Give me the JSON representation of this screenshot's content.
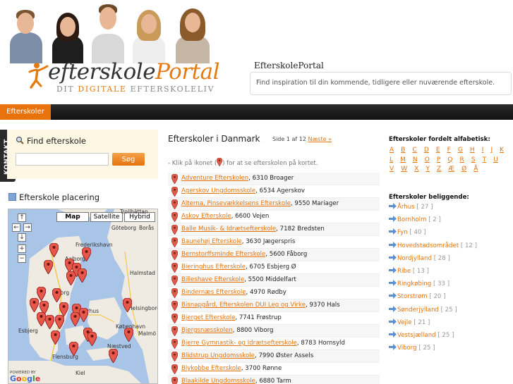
{
  "header": {
    "logo_word1": "efterskole",
    "logo_word2": "Portal",
    "logo_sub_1": "DIT",
    "logo_sub_2": "DIGITALE",
    "logo_sub_3": "EFTERSKOLELIV",
    "site_title": "EfterskolePortal",
    "tagline": "Find inspiration til din kommende, tidligere eller nuværende efterskole."
  },
  "nav": {
    "active_tab": "Efterskoler"
  },
  "kontakt": "KONTAKT",
  "search": {
    "heading": "Find efterskole",
    "placeholder": "",
    "button": "Søg"
  },
  "map_section": {
    "heading": "Efterskole placering",
    "buttons": [
      "Map",
      "Satellite",
      "Hybrid"
    ],
    "cities": [
      "Trollhättan",
      "Göteborg",
      "Borås",
      "Frederikshavn",
      "Aalborg",
      "Halmstad",
      "Viborg",
      "Helsingborg",
      "Aarhus",
      "Esbjerg",
      "København",
      "Malmö",
      "Næstved",
      "Flensburg",
      "Kiel"
    ],
    "powered_by": "POWERED BY",
    "google": "Google"
  },
  "main": {
    "title": "Efterskoler i Danmark",
    "pager_text": "Side 1 af 12",
    "pager_next": "Næste »",
    "hint_before": "- Klik på ikonet (",
    "hint_after": ") for at se efterskolen på kortet.",
    "schools": [
      {
        "name": "Adventure Efterskolen",
        "addr": ", 6310 Broager"
      },
      {
        "name": "Agerskov Ungdomsskole",
        "addr": ", 6534 Agerskov"
      },
      {
        "name": "Alterna, Pinsevækkelsens Efterskole",
        "addr": ", 9550 Mariager"
      },
      {
        "name": "Askov Efterskole",
        "addr": ", 6600 Vejen"
      },
      {
        "name": "Balle Musik- & Idrætsefterskole",
        "addr": ", 7182 Bredsten"
      },
      {
        "name": "Baunehøj Efterskole",
        "addr": ", 3630 Jægerspris"
      },
      {
        "name": "Bernstorffsminde Efterskole",
        "addr": ", 5600 Fåborg"
      },
      {
        "name": "Bieringhus Efterskole",
        "addr": ", 6705 Esbjerg Ø"
      },
      {
        "name": "Billeshave Efterskole",
        "addr": ", 5500 Middelfart"
      },
      {
        "name": "Bindernæs Efterskole",
        "addr": ", 4970 Rødby"
      },
      {
        "name": "Bisnapgård, Efterskolen DUI Leg og Virke",
        "addr": ", 9370 Hals"
      },
      {
        "name": "Bjerget Efterskole",
        "addr": ", 7741 Frøstrup"
      },
      {
        "name": "Bjergsnæsskolen",
        "addr": ", 8800 Viborg"
      },
      {
        "name": "Bjerre Gymnastik- og Idrætsefterskole",
        "addr": ", 8783 Hornsyld"
      },
      {
        "name": "Blidstrup Ungdomsskole",
        "addr": ", 7990 Øster Assels"
      },
      {
        "name": "Blykobbe Efterskole",
        "addr": ", 3700 Rønne"
      },
      {
        "name": "Blaakilde Ungdomsskole",
        "addr": ", 6880 Tarm"
      }
    ]
  },
  "right": {
    "alpha_heading": "Efterskoler fordelt alfabetisk:",
    "letters": [
      "A",
      "B",
      "C",
      "D",
      "E",
      "F",
      "G",
      "H",
      "I",
      "J",
      "K",
      "L",
      "M",
      "N",
      "O",
      "P",
      "Q",
      "R",
      "S",
      "T",
      "U",
      "V",
      "W",
      "X",
      "Y",
      "Z",
      "Æ",
      "Ø",
      "Å"
    ],
    "region_heading": "Efterskoler beliggende:",
    "regions": [
      {
        "name": "Århus",
        "count": "[ 27 ]"
      },
      {
        "name": "Bornholm",
        "count": "[ 2 ]"
      },
      {
        "name": "Fyn",
        "count": "[ 40 ]"
      },
      {
        "name": "Hovedstadsområdet",
        "count": "[ 12 ]"
      },
      {
        "name": "Nordjylland",
        "count": "[ 28 ]"
      },
      {
        "name": "Ribe",
        "count": "[ 13 ]"
      },
      {
        "name": "Ringkøbing",
        "count": "[ 33 ]"
      },
      {
        "name": "Storstrøm",
        "count": "[ 20 ]"
      },
      {
        "name": "Sønderjylland",
        "count": "[ 25 ]"
      },
      {
        "name": "Vejle",
        "count": "[ 21 ]"
      },
      {
        "name": "Vestsjælland",
        "count": "[ 25 ]"
      },
      {
        "name": "Viborg",
        "count": "[ 25 ]"
      }
    ]
  },
  "colors": {
    "accent": "#e5730a",
    "nav_bg": "#1a1a1a",
    "search_bg": "#fdf7e3",
    "map_water": "#a8c4e6"
  }
}
